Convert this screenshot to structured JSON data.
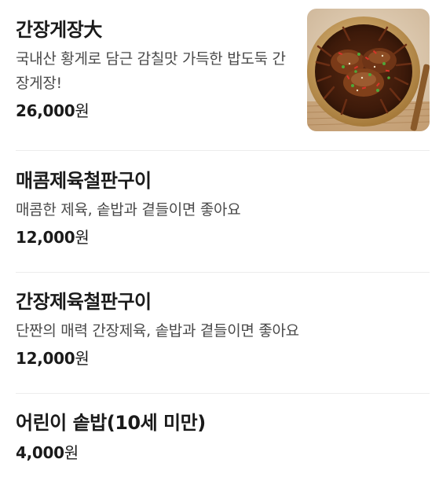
{
  "menu": {
    "items": [
      {
        "name": "간장게장大",
        "description": "국내산 황게로 담근 감칠맛 가득한 밥도둑 간장게장!",
        "price": "26,000",
        "currency": "원",
        "image": "soy-sauce-marinated-crab-photo"
      },
      {
        "name": "매콤제육철판구이",
        "description": "매콤한 제육, 솥밥과 곁들이면 좋아요",
        "price": "12,000",
        "currency": "원"
      },
      {
        "name": "간장제육철판구이",
        "description": "단짠의 매력 간장제육, 솥밥과 곁들이면 좋아요",
        "price": "12,000",
        "currency": "원"
      },
      {
        "name": "어린이 솥밥(10세 미만)",
        "price": "4,000",
        "currency": "원"
      }
    ]
  },
  "colors": {
    "text_primary": "#1a1a1a",
    "text_secondary": "#4a4a4a",
    "divider": "#ececec",
    "background": "#ffffff"
  }
}
